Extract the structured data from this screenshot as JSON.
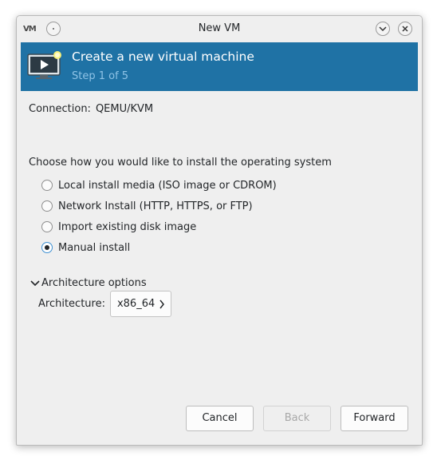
{
  "window": {
    "title": "New VM",
    "app_logo_text": "VM",
    "pin_icon": "pin-icon",
    "minimize_icon": "chevron-down-icon",
    "close_icon": "close-icon"
  },
  "header": {
    "title": "Create a new virtual machine",
    "step": "Step 1 of 5",
    "icon": "monitor-play-icon",
    "background_color": "#1f72a5"
  },
  "connection": {
    "label": "Connection:",
    "value": "QEMU/KVM"
  },
  "install": {
    "heading": "Choose how you would like to install the operating system",
    "options": [
      {
        "label": "Local install media (ISO image or CDROM)",
        "selected": false
      },
      {
        "label": "Network Install (HTTP, HTTPS, or FTP)",
        "selected": false
      },
      {
        "label": "Import existing disk image",
        "selected": false
      },
      {
        "label": "Manual install",
        "selected": true
      }
    ]
  },
  "architecture": {
    "expander_label": "Architecture options",
    "expanded": true,
    "field_label": "Architecture:",
    "value": "x86_64"
  },
  "footer": {
    "cancel_label": "Cancel",
    "back_label": "Back",
    "back_enabled": false,
    "forward_label": "Forward"
  }
}
